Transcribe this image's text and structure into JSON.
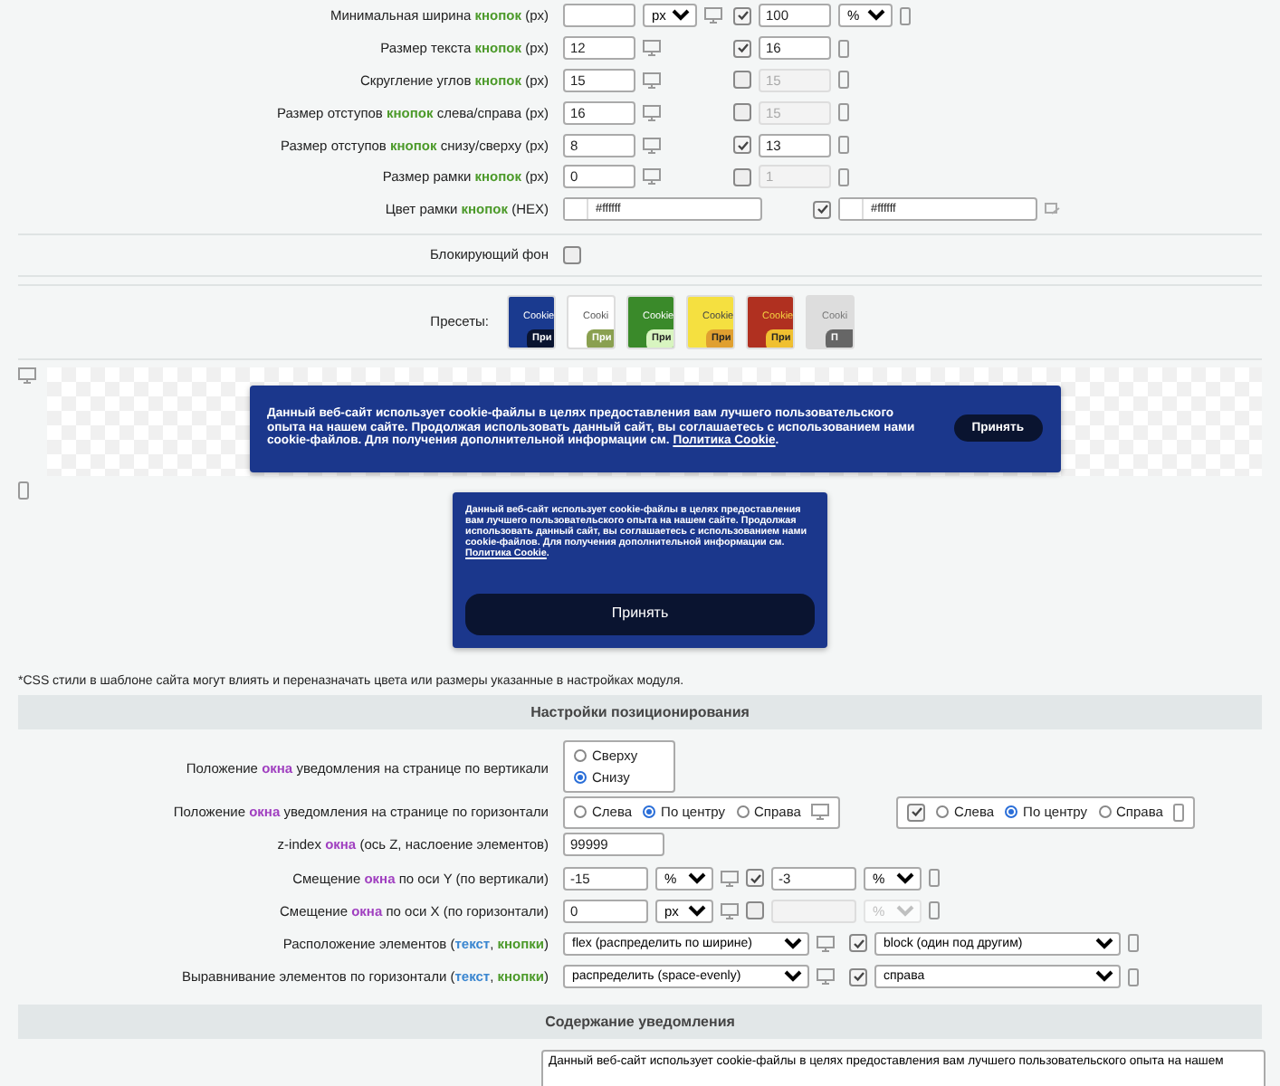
{
  "button_rows": [
    {
      "kind": "number",
      "label": [
        {
          "text": "Минимальная ширина "
        },
        {
          "text": "кнопок",
          "kind": "button"
        },
        {
          "text": " (px)"
        }
      ],
      "desktop": {
        "unit": "px"
      },
      "mobile": {
        "checked": true,
        "value": "100",
        "unit": "%"
      }
    },
    {
      "kind": "number",
      "label": [
        {
          "text": "Размер текста "
        },
        {
          "text": "кнопок",
          "kind": "button"
        },
        {
          "text": " (px)"
        }
      ],
      "desktop": {
        "value": "12"
      },
      "mobile": {
        "checked": true,
        "value": "16"
      }
    },
    {
      "kind": "number",
      "label": [
        {
          "text": "Скругление углов "
        },
        {
          "text": "кнопок",
          "kind": "button"
        },
        {
          "text": " (px)"
        }
      ],
      "desktop": {
        "value": "15"
      },
      "mobile": {
        "checked": false,
        "value": "15"
      }
    },
    {
      "kind": "number",
      "label": [
        {
          "text": "Размер отступов "
        },
        {
          "text": "кнопок",
          "kind": "button"
        },
        {
          "text": " слева/справа (px)"
        }
      ],
      "desktop": {
        "value": "16"
      },
      "mobile": {
        "checked": false,
        "value": "15"
      }
    },
    {
      "kind": "number",
      "label": [
        {
          "text": "Размер отступов "
        },
        {
          "text": "кнопок",
          "kind": "button"
        },
        {
          "text": " снизу/сверху (px)"
        }
      ],
      "desktop": {
        "value": "8"
      },
      "mobile": {
        "checked": true,
        "value": "13"
      }
    },
    {
      "kind": "number",
      "label": [
        {
          "text": "Размер рамки "
        },
        {
          "text": "кнопок",
          "kind": "button"
        },
        {
          "text": " (px)"
        }
      ],
      "desktop": {
        "value": "0"
      },
      "mobile": {
        "checked": false,
        "value": "1"
      }
    },
    {
      "kind": "color",
      "label": [
        {
          "text": "Цвет рамки "
        },
        {
          "text": "кнопок",
          "kind": "button"
        },
        {
          "text": " (HEX)"
        }
      ],
      "desktop": {
        "value": "#ffffff",
        "color": "#ffffff"
      },
      "mobile": {
        "checked": true,
        "value": "#ffffff",
        "color": "#ffffff"
      }
    }
  ],
  "blocking_background": {
    "label": "Блокирующий фон",
    "checked": false
  },
  "presets": {
    "label": "Пресеты:",
    "items": [
      {
        "color": "#1a3a8f",
        "title": {
          "text": "Cookie",
          "color": "#ffffff"
        },
        "button": {
          "label": "При",
          "color": "#0a1430"
        }
      },
      {
        "color": "#ffffff",
        "title": {
          "text": "Cooki",
          "color": "#555555"
        },
        "button": {
          "label": "При",
          "color": "#8aa050"
        }
      },
      {
        "color": "#3a8a2a",
        "title": {
          "text": "Cookie",
          "color": "#ffffff"
        },
        "button": {
          "label": "При",
          "color": "#d8f5c0"
        }
      },
      {
        "color": "#f5e040",
        "title": {
          "text": "Cookie",
          "color": "#444444"
        },
        "button": {
          "label": "При",
          "color": "#e0a030"
        }
      },
      {
        "color": "#b03020",
        "title": {
          "text": "Cookie",
          "color": "#f5d040"
        },
        "button": {
          "label": "При",
          "color": "#f0c030"
        }
      },
      {
        "color": "#dddddd",
        "title": {
          "text": "Cooki",
          "color": "#777777"
        },
        "button": {
          "label": "П",
          "color": "#666666"
        }
      }
    ]
  },
  "preview_desktop": {
    "text": "Данный веб-сайт использует cookie-файлы в целях предоставления вам лучшего пользовательского опыта на нашем сайте. Продолжая использовать данный сайт, вы соглашаетесь с использованием нами cookie-файлов. Для получения дополнительной информации см.",
    "link": "Политика Cookie",
    "after": ".",
    "button": "Принять"
  },
  "preview_mobile": {
    "text": "Данный веб-сайт использует cookie-файлы в целях предоставления вам лучшего пользовательского опыта на нашем сайте. Продолжая использовать данный сайт, вы соглашаетесь с использованием нами cookie-файлов. Для получения дополнительной информации см.",
    "link": "Политика Cookie",
    "after": ".",
    "button": "Принять"
  },
  "note": "*CSS стили в шаблоне сайта могут влиять и переназначать цвета или размеры указанные в настройках модуля.",
  "positioning": {
    "title": "Настройки позиционирования",
    "rows": [
      {
        "kind": "radio_stack",
        "label": [
          {
            "text": "Положение "
          },
          {
            "text": "окна",
            "kind": "window"
          },
          {
            "text": " уведомления на странице по вертикали"
          }
        ],
        "options": [
          {
            "label": "Сверху",
            "selected": false
          },
          {
            "label": "Снизу",
            "selected": true
          }
        ]
      },
      {
        "kind": "radio_row",
        "label": [
          {
            "text": "Положение "
          },
          {
            "text": "окна",
            "kind": "window"
          },
          {
            "text": " уведомления на странице по горизонтали"
          }
        ],
        "desktop": {
          "options": [
            {
              "label": "Слева",
              "selected": false
            },
            {
              "label": "По центру",
              "selected": true
            },
            {
              "label": "Справа",
              "selected": false
            }
          ]
        },
        "mobile": {
          "checked": true,
          "options": [
            {
              "label": "Слева",
              "selected": false
            },
            {
              "label": "По центру",
              "selected": true
            },
            {
              "label": "Справа",
              "selected": false
            }
          ]
        }
      },
      {
        "kind": "number",
        "label": [
          {
            "text": "z-index "
          },
          {
            "text": "окна",
            "kind": "window"
          },
          {
            "text": " (ось Z, наслоение элементов)"
          }
        ],
        "desktop": {
          "value": "99999"
        }
      },
      {
        "kind": "number",
        "label": [
          {
            "text": "Смещение "
          },
          {
            "text": "окна",
            "kind": "window"
          },
          {
            "text": " по оси Y (по вертикали)"
          }
        ],
        "desktop": {
          "value": "-15",
          "unit": "%"
        },
        "mobile": {
          "checked": true,
          "value": "-3",
          "unit": "%"
        }
      },
      {
        "kind": "number",
        "label": [
          {
            "text": "Смещение "
          },
          {
            "text": "окна",
            "kind": "window"
          },
          {
            "text": " по оси X (по горизонтали)"
          }
        ],
        "desktop": {
          "value": "0",
          "unit": "px"
        },
        "mobile": {
          "checked": false,
          "unit": "%"
        }
      },
      {
        "kind": "select",
        "label": [
          {
            "text": "Расположение элементов ("
          },
          {
            "text": "текст",
            "kind": "text"
          },
          {
            "text": ", "
          },
          {
            "text": "кнопки",
            "kind": "button"
          },
          {
            "text": ")"
          }
        ],
        "desktop": {
          "value": "flex (распределить по ширине)"
        },
        "mobile": {
          "checked": true,
          "value": "block (один под другим)"
        }
      },
      {
        "kind": "select",
        "label": [
          {
            "text": "Выравнивание элементов по горизонтали ("
          },
          {
            "text": "текст",
            "kind": "text"
          },
          {
            "text": ", "
          },
          {
            "text": "кнопки",
            "kind": "button"
          },
          {
            "text": ")"
          }
        ],
        "desktop": {
          "value": "распределить (space-evenly)"
        },
        "mobile": {
          "checked": true,
          "value": "справа"
        }
      }
    ]
  },
  "content": {
    "title": "Содержание уведомления",
    "text": "Данный веб-сайт использует cookie-файлы в целях предоставления вам лучшего пользовательского опыта на нашем"
  }
}
